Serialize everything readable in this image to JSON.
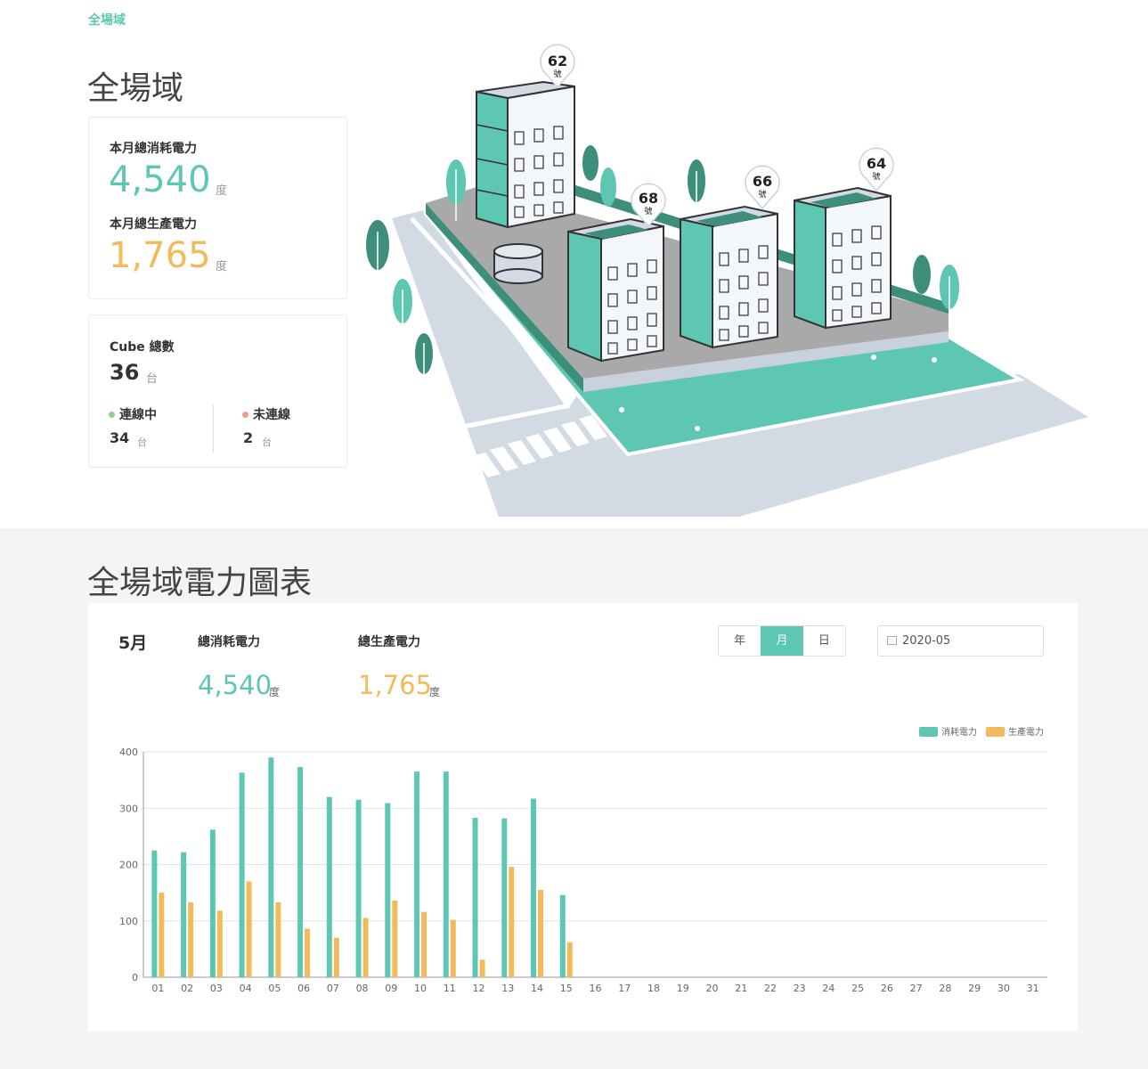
{
  "breadcrumb": "全場域",
  "title": "全場域",
  "power_card": {
    "consumption_label": "本月總消耗電力",
    "consumption_value": "4,540",
    "generation_label": "本月總生產電力",
    "generation_value": "1,765",
    "unit": "度"
  },
  "cube_card": {
    "label": "Cube 總數",
    "total": "36",
    "unit": "台",
    "online_label": "連線中",
    "online_value": "34",
    "offline_label": "未連線",
    "offline_value": "2"
  },
  "buildings": [
    {
      "number": "62",
      "suffix": "號"
    },
    {
      "number": "68",
      "suffix": "號"
    },
    {
      "number": "66",
      "suffix": "號"
    },
    {
      "number": "64",
      "suffix": "號"
    }
  ],
  "chart_section": {
    "title": "全場域電力圖表",
    "month": "5月",
    "consumption_label": "總消耗電力",
    "consumption_value": "4,540",
    "generation_label": "總生產電力",
    "generation_value": "1,765",
    "unit": "度",
    "period_tabs": [
      "年",
      "月",
      "日"
    ],
    "active_tab": "月",
    "date_value": "2020-05"
  },
  "colors": {
    "teal": "#5ec7b3",
    "orange": "#f1bb5c",
    "online": "#8fd18b",
    "offline": "#f29a9a"
  },
  "chart_data": {
    "type": "bar",
    "categories": [
      "01",
      "02",
      "03",
      "04",
      "05",
      "06",
      "07",
      "08",
      "09",
      "10",
      "11",
      "12",
      "13",
      "14",
      "15",
      "16",
      "17",
      "18",
      "19",
      "20",
      "21",
      "22",
      "23",
      "24",
      "25",
      "26",
      "27",
      "28",
      "29",
      "30",
      "31"
    ],
    "series": [
      {
        "name": "消耗電力",
        "color": "#5ec7b3",
        "values": [
          225,
          222,
          262,
          363,
          390,
          373,
          320,
          315,
          309,
          365,
          365,
          283,
          282,
          317,
          146,
          null,
          null,
          null,
          null,
          null,
          null,
          null,
          null,
          null,
          null,
          null,
          null,
          null,
          null,
          null,
          null
        ]
      },
      {
        "name": "生產電力",
        "color": "#f1bb5c",
        "values": [
          150,
          133,
          118,
          170,
          133,
          86,
          70,
          105,
          136,
          116,
          102,
          31,
          196,
          155,
          62,
          null,
          null,
          null,
          null,
          null,
          null,
          null,
          null,
          null,
          null,
          null,
          null,
          null,
          null,
          null,
          null
        ]
      }
    ],
    "yticks": [
      0,
      100,
      200,
      300,
      400
    ],
    "ylim": [
      0,
      400
    ],
    "grid": true,
    "legend": "top-right"
  }
}
